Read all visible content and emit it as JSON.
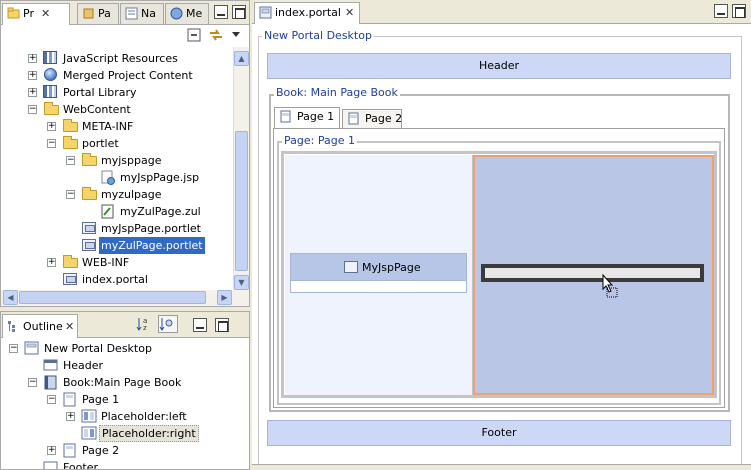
{
  "left_tabs": [
    {
      "label": "Pr",
      "active": true
    },
    {
      "label": "Pa",
      "active": false
    },
    {
      "label": "Na",
      "active": false
    },
    {
      "label": "Me",
      "active": false
    }
  ],
  "project_tree": [
    {
      "label": "JavaScript Resources",
      "icon": "library-icon",
      "expander": "+"
    },
    {
      "label": "Merged Project Content",
      "icon": "globe-icon",
      "expander": "+"
    },
    {
      "label": "Portal Library",
      "icon": "library-icon",
      "expander": "+"
    },
    {
      "label": "WebContent",
      "icon": "folder-open-icon",
      "expander": "−"
    },
    {
      "label": "META-INF",
      "icon": "folder-icon",
      "expander": "+"
    },
    {
      "label": "portlet",
      "icon": "folder-open-icon",
      "expander": "−"
    },
    {
      "label": "myjsppage",
      "icon": "folder-open-icon",
      "expander": "−"
    },
    {
      "label": "myJspPage.jsp",
      "icon": "jsp-file-icon",
      "expander": ""
    },
    {
      "label": "myzulpage",
      "icon": "folder-open-icon",
      "expander": "−"
    },
    {
      "label": "myZulPage.zul",
      "icon": "zul-file-icon",
      "expander": ""
    },
    {
      "label": "myJspPage.portlet",
      "icon": "portlet-file-icon",
      "expander": ""
    },
    {
      "label": "myZulPage.portlet",
      "icon": "portlet-file-icon",
      "expander": ""
    },
    {
      "label": "WEB-INF",
      "icon": "folder-icon",
      "expander": "+"
    },
    {
      "label": "index.portal",
      "icon": "portal-file-icon",
      "expander": ""
    }
  ],
  "outline": {
    "tab_label": "Outline",
    "items": [
      {
        "label": "New Portal Desktop",
        "expander": "−"
      },
      {
        "label": "Header",
        "expander": ""
      },
      {
        "label": "Book:Main Page Book",
        "expander": "−"
      },
      {
        "label": "Page 1",
        "expander": "−"
      },
      {
        "label": "Placeholder:left",
        "expander": "+"
      },
      {
        "label": "Placeholder:right",
        "expander": ""
      },
      {
        "label": "Page 2",
        "expander": "+"
      },
      {
        "label": "Footer",
        "expander": ""
      }
    ]
  },
  "editor": {
    "tab_label": "index.portal",
    "desktop_title": "New Portal Desktop",
    "header_label": "Header",
    "book_title": "Book: Main Page Book",
    "page_tabs": [
      "Page 1",
      "Page 2"
    ],
    "page_title": "Page: Page 1",
    "portlet_label": "MyJspPage",
    "footer_label": "Footer"
  },
  "colors": {
    "selection": "#316ac5",
    "region_fill": "#ccd8f5",
    "drop_highlight": "#f0a070",
    "title_blue": "#1c3fa2"
  }
}
